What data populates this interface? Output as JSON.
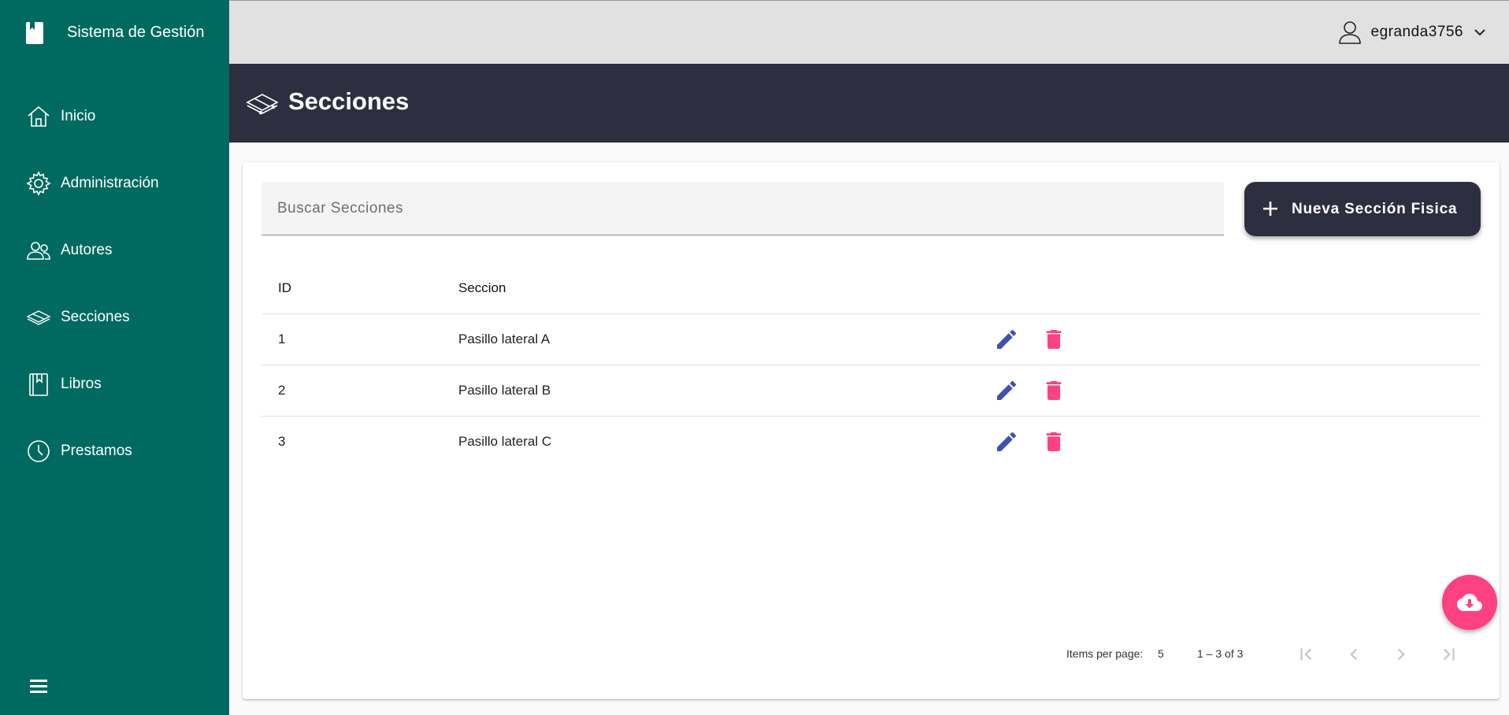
{
  "app": {
    "title": "Sistema de Gestión"
  },
  "sidebar": {
    "items": [
      {
        "label": "Inicio",
        "icon": "home-icon"
      },
      {
        "label": "Administración",
        "icon": "gear-icon"
      },
      {
        "label": "Autores",
        "icon": "people-icon"
      },
      {
        "label": "Secciones",
        "icon": "layers-icon"
      },
      {
        "label": "Libros",
        "icon": "book-icon"
      },
      {
        "label": "Prestamos",
        "icon": "clock-icon"
      }
    ]
  },
  "user": {
    "name": "egranda3756"
  },
  "page": {
    "title": "Secciones"
  },
  "search": {
    "placeholder": "Buscar Secciones",
    "value": ""
  },
  "actions": {
    "new_label": "Nueva Sección Fisica"
  },
  "table": {
    "headers": {
      "id": "ID",
      "section": "Seccion"
    },
    "rows": [
      {
        "id": "1",
        "section": "Pasillo lateral A"
      },
      {
        "id": "2",
        "section": "Pasillo lateral B"
      },
      {
        "id": "3",
        "section": "Pasillo lateral C"
      }
    ]
  },
  "paginator": {
    "items_per_page_label": "Items per page:",
    "page_size": "5",
    "range": "1 – 3 of 3"
  },
  "colors": {
    "sidebar": "#006a61",
    "header": "#2d2f40",
    "edit": "#3f51b5",
    "delete": "#ff4081",
    "fab": "#ff4081"
  }
}
